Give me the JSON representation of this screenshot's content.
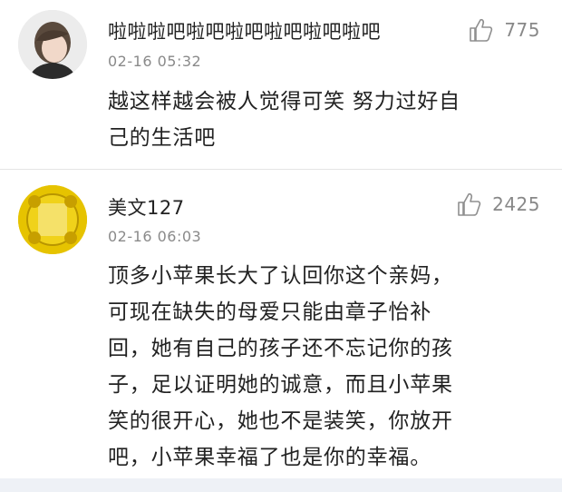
{
  "comments": [
    {
      "username": "啦啦啦吧啦吧啦吧啦吧啦吧啦吧",
      "time": "02-16 05:32",
      "likes": "775",
      "lines": [
        "越这样越会被人觉得可笑 努力过好自",
        "己的生活吧"
      ]
    },
    {
      "username": "美文127",
      "time": "02-16 06:03",
      "likes": "2425",
      "lines": [
        "顶多小苹果长大了认回你这个亲妈，",
        "可现在缺失的母爱只能由章子怡补",
        "回，她有自己的孩子还不忘记你的孩",
        "子，足以证明她的诚意，而且小苹果",
        "笑的很开心，她也不是装笑，你放开",
        "吧，小苹果幸福了也是你的幸福。"
      ]
    }
  ],
  "icons": {
    "like": "thumbs-up-icon"
  },
  "colors": {
    "background": "#ffffff",
    "text": "#222222",
    "muted": "#8a8a8a",
    "avatar2": "#e8c500"
  }
}
